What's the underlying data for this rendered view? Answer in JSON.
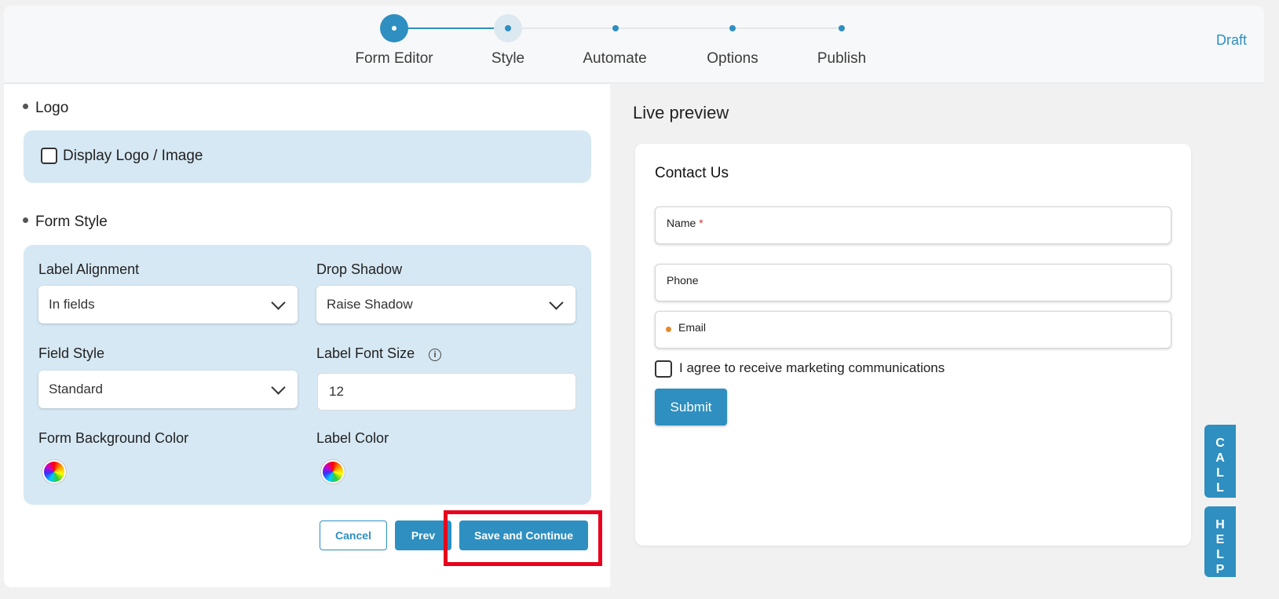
{
  "stepper": {
    "steps": [
      {
        "label": "Form Editor"
      },
      {
        "label": "Style"
      },
      {
        "label": "Automate"
      },
      {
        "label": "Options"
      },
      {
        "label": "Publish"
      }
    ],
    "status": "Draft"
  },
  "editor": {
    "logo_section": {
      "title": "Logo",
      "checkbox_label": "Display Logo / Image",
      "checked": false
    },
    "form_style": {
      "title": "Form Style",
      "label_alignment": {
        "label": "Label Alignment",
        "value": "In fields"
      },
      "drop_shadow": {
        "label": "Drop Shadow",
        "value": "Raise Shadow"
      },
      "field_style": {
        "label": "Field Style",
        "value": "Standard"
      },
      "label_font_size": {
        "label": "Label Font Size",
        "value": "12"
      },
      "form_background_color": {
        "label": "Form Background Color"
      },
      "label_color": {
        "label": "Label Color"
      }
    },
    "actions": {
      "cancel": "Cancel",
      "prev": "Prev",
      "save": "Save and Continue"
    }
  },
  "preview": {
    "title": "Live preview",
    "form_heading": "Contact Us",
    "fields": [
      {
        "label": "Name",
        "required_mark": "*"
      },
      {
        "label": "Phone"
      },
      {
        "label": "Email"
      }
    ],
    "consent_label": "I agree to receive marketing communications",
    "submit_label": "Submit"
  },
  "side_tabs": {
    "call": [
      "C",
      "A",
      "L",
      "L"
    ],
    "help": [
      "H",
      "E",
      "L",
      "P"
    ]
  },
  "colors": {
    "accent": "#2e8fc0",
    "panel_bg": "#d6e8f4",
    "highlight": "#e8001c",
    "required": "#d9342b",
    "email_dot": "#e58a2a"
  },
  "icons": [
    "info-icon",
    "chevron-down-icon",
    "color-wheel-icon",
    "checkbox-icon"
  ]
}
